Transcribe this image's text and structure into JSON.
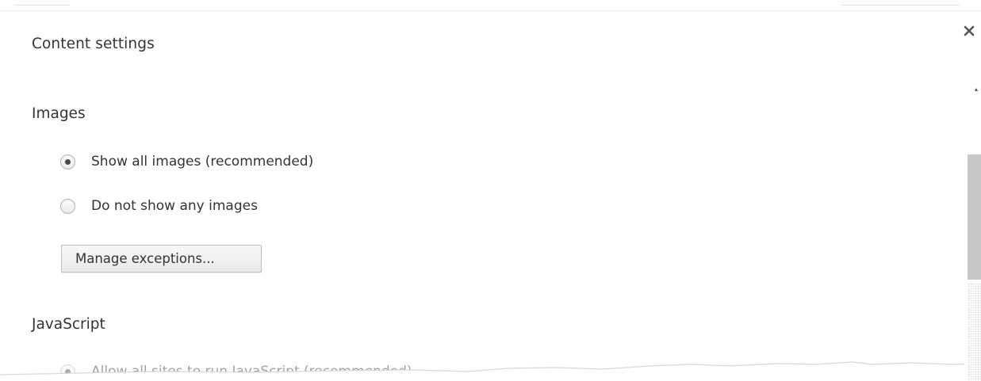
{
  "dialog": {
    "title": "Content settings",
    "close_icon": "close-icon"
  },
  "images_section": {
    "heading": "Images",
    "options": [
      {
        "label": "Show all images (recommended)",
        "checked": true
      },
      {
        "label": "Do not show any images",
        "checked": false
      }
    ],
    "manage_button_label": "Manage exceptions..."
  },
  "javascript_section": {
    "heading": "JavaScript",
    "options": [
      {
        "label": "Allow all sites to run JavaScript (recommended)",
        "checked": true
      }
    ]
  },
  "scrollbar": {
    "up_arrow_icon": "scroll-up-arrow-icon"
  }
}
